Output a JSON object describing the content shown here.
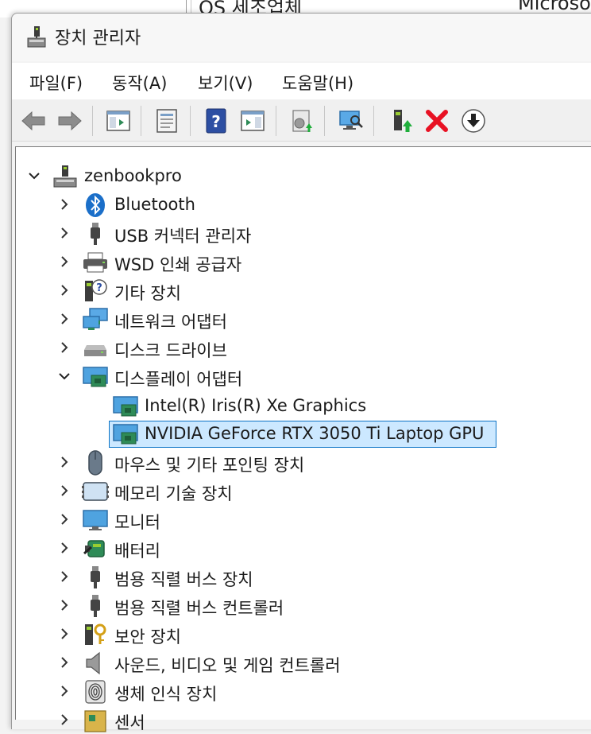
{
  "background_window": {
    "text_left": "OS 세조업체",
    "text_right": "Microso"
  },
  "window": {
    "title": "장치 관리자"
  },
  "menu": [
    {
      "label": "파일(F)"
    },
    {
      "label": "동작(A)"
    },
    {
      "label": "보기(V)"
    },
    {
      "label": "도움말(H)"
    }
  ],
  "toolbar": [
    "back-arrow-icon",
    "forward-arrow-icon",
    "show-hide-console-tree-icon",
    "properties-icon",
    "help-icon",
    "action-pane-icon",
    "update-driver-icon",
    "scan-hardware-icon",
    "enable-device-icon",
    "uninstall-device-icon",
    "download-icon"
  ],
  "tree": {
    "root": {
      "label": "zenbookpro",
      "expanded": true,
      "icon": "computer-icon"
    },
    "items": [
      {
        "label": "Bluetooth",
        "icon": "bluetooth-icon",
        "expanded": false
      },
      {
        "label": "USB 커넥터 관리자",
        "icon": "usb-connector-icon",
        "expanded": false
      },
      {
        "label": "WSD 인쇄 공급자",
        "icon": "printer-icon",
        "expanded": false
      },
      {
        "label": "기타 장치",
        "icon": "unknown-device-icon",
        "expanded": false
      },
      {
        "label": "네트워크 어댑터",
        "icon": "network-adapter-icon",
        "expanded": false
      },
      {
        "label": "디스크 드라이브",
        "icon": "disk-drive-icon",
        "expanded": false
      },
      {
        "label": "디스플레이 어댑터",
        "icon": "display-adapter-icon",
        "expanded": true,
        "children": [
          {
            "label": "Intel(R) Iris(R) Xe Graphics",
            "icon": "display-adapter-icon",
            "selected": false
          },
          {
            "label": "NVIDIA GeForce RTX 3050 Ti Laptop GPU",
            "icon": "display-adapter-icon",
            "selected": true
          }
        ]
      },
      {
        "label": "마우스 및 기타 포인팅 장치",
        "icon": "mouse-icon",
        "expanded": false
      },
      {
        "label": "메모리 기술 장치",
        "icon": "memory-device-icon",
        "expanded": false
      },
      {
        "label": "모니터",
        "icon": "monitor-icon",
        "expanded": false
      },
      {
        "label": "배터리",
        "icon": "battery-icon",
        "expanded": false
      },
      {
        "label": "범용 직렬 버스 장치",
        "icon": "usb-device-icon",
        "expanded": false
      },
      {
        "label": "범용 직렬 버스 컨트롤러",
        "icon": "usb-controller-icon",
        "expanded": false
      },
      {
        "label": "보안 장치",
        "icon": "security-device-icon",
        "expanded": false
      },
      {
        "label": "사운드, 비디오 및 게임 컨트롤러",
        "icon": "speaker-icon",
        "expanded": false
      },
      {
        "label": "생체 인식 장치",
        "icon": "fingerprint-icon",
        "expanded": false
      },
      {
        "label": "센서",
        "icon": "sensor-icon",
        "expanded": false
      }
    ]
  },
  "colors": {
    "selection_bg": "#cce8ff",
    "selection_border": "#0b73c6",
    "uninstall_red": "#e81123"
  }
}
